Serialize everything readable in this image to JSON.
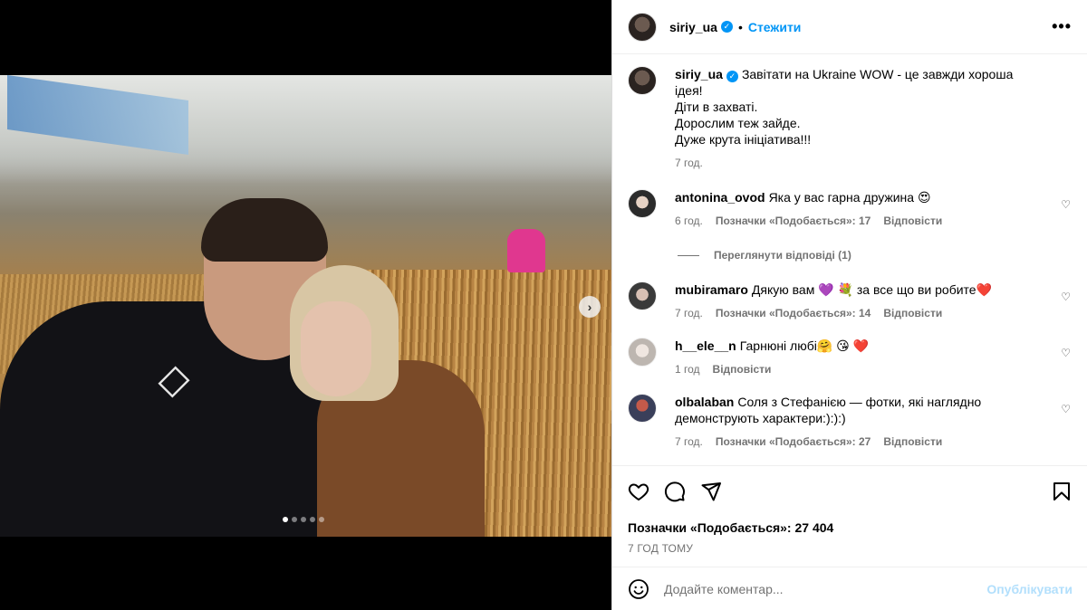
{
  "post": {
    "author": "siriy_ua",
    "follow_label": "Стежити",
    "separator": "•",
    "more_label": "•••"
  },
  "media": {
    "slide_count": 5,
    "active_slide": 1,
    "next_label": "›"
  },
  "caption": {
    "username": "siriy_ua",
    "lines": [
      "Завітати на Ukraine WOW - це завжди хороша ідея!",
      "Діти в захваті.",
      "Дорослим теж зайде.",
      "Дуже крута ініціатива!!!"
    ],
    "time": "7 год."
  },
  "comments": [
    {
      "username": "antonina_ovod",
      "text": "Яка у вас гарна дружина 😍",
      "time": "6 год.",
      "likes": "Позначки «Подобається»: 17",
      "reply": "Відповісти",
      "view_replies": "Переглянути відповіді (1)"
    },
    {
      "username": "mubiramaro",
      "text": "Дякую вам 💜 💐 за все що ви робите❤️",
      "time": "7 год.",
      "likes": "Позначки «Подобається»: 14",
      "reply": "Відповісти"
    },
    {
      "username": "h__ele__n",
      "text": "Гарнюні любі🤗 😘 ❤️",
      "time": "1 год",
      "reply": "Відповісти"
    },
    {
      "username": "olbalaban",
      "text": "Соля з Стефанією — фотки, які наглядно демонструють характери:):):)",
      "time": "7 год.",
      "likes": "Позначки «Подобається»: 27",
      "reply": "Відповісти"
    }
  ],
  "actions": {
    "likes_total": "Позначки «Подобається»: 27 404",
    "posted_ago": "7 ГОД ТОМУ"
  },
  "composer": {
    "placeholder": "Додайте коментар...",
    "publish_label": "Опублікувати"
  },
  "colors": {
    "accent": "#0095f6",
    "publish_disabled": "#b2dffc",
    "muted": "#737373"
  }
}
